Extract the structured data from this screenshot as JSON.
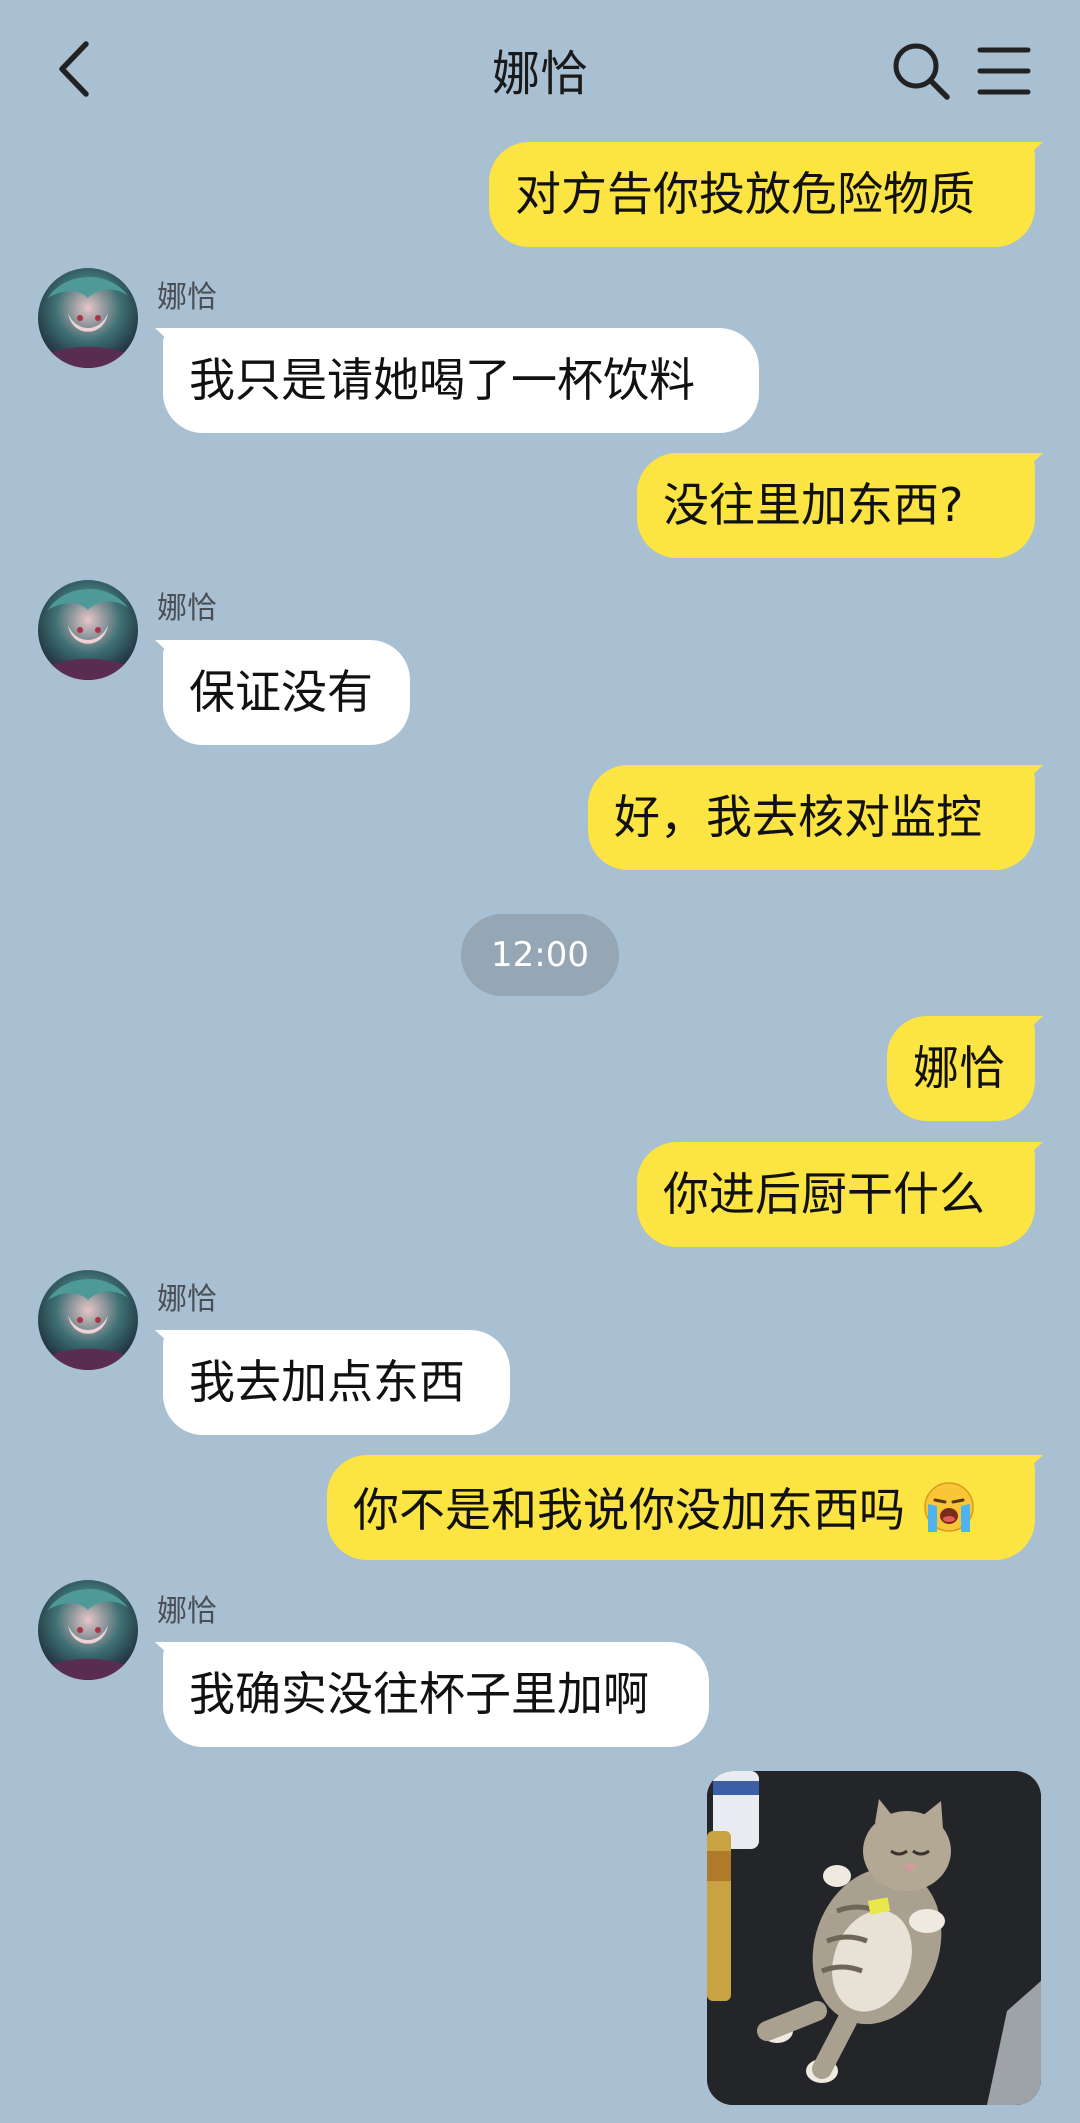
{
  "header": {
    "title": "娜恰"
  },
  "contact_name": "娜恰",
  "timestamp": "12:00",
  "messages": [
    {
      "side": "me",
      "text": "对方告你投放危险物质"
    },
    {
      "side": "other",
      "sender": "娜恰",
      "text": "我只是请她喝了一杯饮料"
    },
    {
      "side": "me",
      "text": "没往里加东西?"
    },
    {
      "side": "other",
      "sender": "娜恰",
      "text": "保证没有"
    },
    {
      "side": "me",
      "text": "好，我去核对监控"
    },
    {
      "side": "me",
      "text": "娜恰"
    },
    {
      "side": "me",
      "text": "你进后厨干什么"
    },
    {
      "side": "other",
      "sender": "娜恰",
      "text": "我去加点东西"
    },
    {
      "side": "me",
      "text": "你不是和我说你没加东西吗",
      "emoji": "loudly-crying-face"
    },
    {
      "side": "other",
      "sender": "娜恰",
      "text": "我确实没往杯子里加啊"
    }
  ],
  "image_message": {
    "side": "me",
    "content": "photo-of-kitten-lying-on-back"
  },
  "colors": {
    "background": "#a9bfd2",
    "my_bubble": "#fce443",
    "their_bubble": "#ffffff",
    "timestamp_pill": "#95a6b4"
  },
  "icons": [
    "back-arrow-icon",
    "search-icon",
    "menu-icon"
  ]
}
